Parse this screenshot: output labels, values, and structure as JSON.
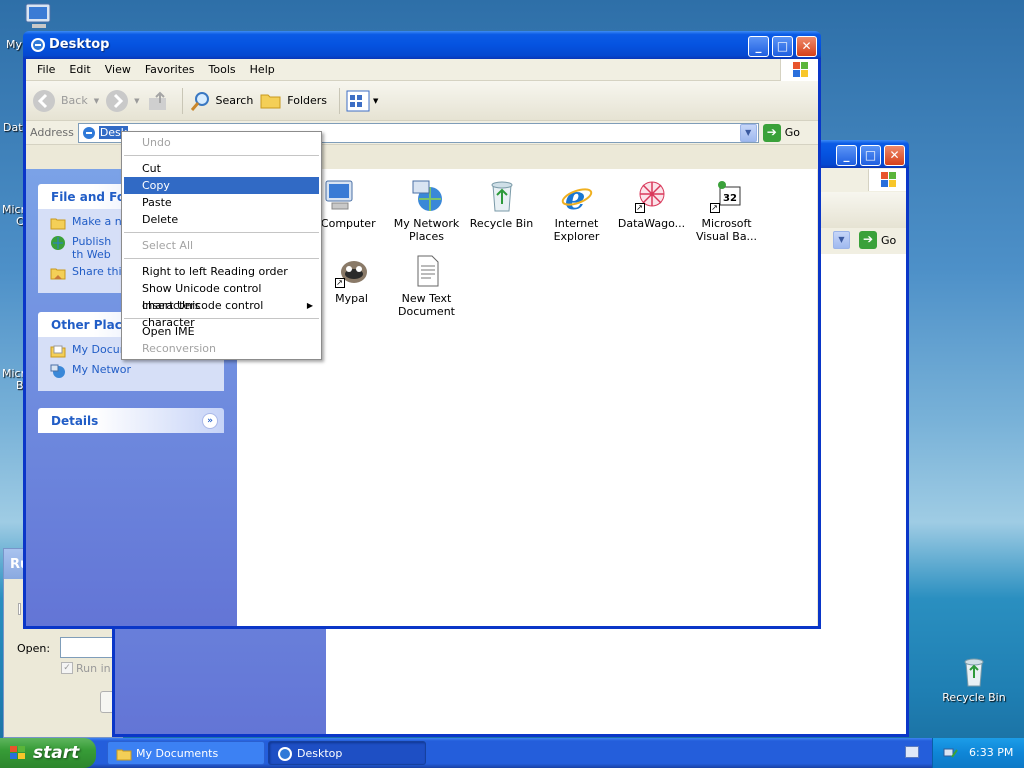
{
  "desktop": {
    "icons": [
      {
        "name": "desktop-icon-recycle-bin",
        "label": "Recycle Bin"
      }
    ],
    "fragments": [
      "My",
      "Dat",
      "Micr",
      "C",
      "Micr",
      "B"
    ]
  },
  "explorer": {
    "title": "Desktop",
    "menu": [
      "File",
      "Edit",
      "View",
      "Favorites",
      "Tools",
      "Help"
    ],
    "toolbar": {
      "back": "Back",
      "search": "Search",
      "folders": "Folders"
    },
    "address": {
      "label": "Address",
      "value": "Desk",
      "go": "Go"
    },
    "taskpane": {
      "file_folder_title": "File and Fold",
      "file_tasks": [
        "Make a ne",
        "Publish th Web",
        "Share this"
      ],
      "other_places_title": "Other Places",
      "other_places": [
        "My Docum",
        "My Networ"
      ],
      "details_title": "Details"
    },
    "items": [
      {
        "label": "My Computer",
        "icon": "computer-icon"
      },
      {
        "label": "My Network Places",
        "icon": "network-places-icon"
      },
      {
        "label": "Recycle Bin",
        "icon": "recycle-bin-icon"
      },
      {
        "label": "Internet Explorer",
        "icon": "internet-explorer-icon"
      },
      {
        "label": "DataWago...",
        "icon": "datawagon-icon"
      },
      {
        "label": "Microsoft Visual Ba...",
        "icon": "visual-basic-icon"
      },
      {
        "label": "Mypal",
        "icon": "mypal-icon"
      },
      {
        "label": "New Text Document",
        "icon": "text-document-icon"
      }
    ]
  },
  "context_menu": {
    "items": [
      {
        "label": "Undo",
        "enabled": false
      },
      {
        "label": "Cut",
        "enabled": true
      },
      {
        "label": "Copy",
        "enabled": true,
        "highlighted": true
      },
      {
        "label": "Paste",
        "enabled": true
      },
      {
        "label": "Delete",
        "enabled": true
      },
      {
        "label": "Select All",
        "enabled": false
      },
      {
        "label": "Right to left Reading order",
        "enabled": true
      },
      {
        "label": "Show Unicode control characters",
        "enabled": true
      },
      {
        "label": "Insert Unicode control character",
        "enabled": true,
        "submenu": true
      },
      {
        "label": "Open IME",
        "enabled": true
      },
      {
        "label": "Reconversion",
        "enabled": false
      }
    ]
  },
  "back_window": {
    "go": "Go"
  },
  "run_dialog": {
    "title_fragment": "Ru",
    "open_label": "Open:",
    "run_in_label": "Run in s"
  },
  "taskbar": {
    "start": "start",
    "buttons": [
      "My Documents",
      "Desktop"
    ],
    "clock": "6:33 PM"
  },
  "colors": {
    "title_blue": "#0553e0",
    "selection": "#316ac5",
    "start_green": "#379c37",
    "taskpane_link": "#215dc6"
  }
}
